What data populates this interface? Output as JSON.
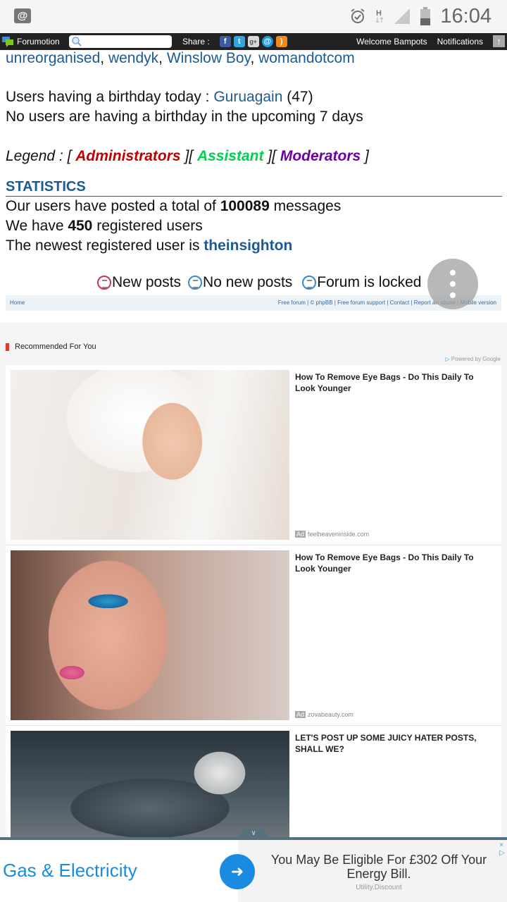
{
  "status_bar": {
    "notification_icon": "at-sign-icon",
    "icons": [
      "alarm-icon",
      "hspa-data-icon",
      "signal-icon",
      "battery-icon"
    ],
    "time": "16:04"
  },
  "topbar": {
    "brand": "Forumotion",
    "search_placeholder": "",
    "share_label": "Share :",
    "share_icons": [
      "facebook-icon",
      "twitter-icon",
      "google-plus-icon",
      "email-icon",
      "rss-icon"
    ],
    "welcome": "Welcome Bampots",
    "notifications": "Notifications"
  },
  "online_users": {
    "users": [
      "unreorganised",
      "wendyk",
      "Winslow Boy",
      "womandotcom"
    ],
    "separator": ", "
  },
  "birthdays": {
    "today_label": "Users having a birthday today : ",
    "today_user": "Guruagain",
    "today_age": " (47)",
    "upcoming": "No users are having a birthday in the upcoming 7 days"
  },
  "legend": {
    "prefix": "Legend : [ ",
    "groups": [
      {
        "name": "Administrators",
        "color": "#c00000"
      },
      {
        "name": "Assistant",
        "color": "#00d050"
      },
      {
        "name": "Moderators",
        "color": "#7000a0"
      }
    ],
    "sep1": " ][ ",
    "sep2": " ][ ",
    "suffix": " ]"
  },
  "statistics": {
    "heading": "STATISTICS",
    "posts_prefix": "Our users have posted a total of ",
    "posts_count": "100089",
    "posts_suffix": " messages",
    "users_prefix": "We have ",
    "users_count": "450",
    "users_suffix": " registered users",
    "newest_prefix": "The newest registered user is ",
    "newest_user": "theinsighton"
  },
  "icon_legend": [
    {
      "label": "New posts",
      "icon": "new-posts-icon",
      "color": "#d0304a"
    },
    {
      "label": "No new posts",
      "icon": "no-new-posts-icon",
      "color": "#3a88c8"
    },
    {
      "label": "Forum is locked",
      "icon": "forum-locked-icon",
      "color": "#3a88c8"
    }
  ],
  "footer": {
    "home": "Home",
    "links": [
      "Free forum",
      "© phpBB",
      "Free forum support",
      "Contact",
      "Report an abuse",
      "Mobile version"
    ],
    "separator": " | "
  },
  "recommended": {
    "title": "Recommended For You",
    "powered": "Powered by Google",
    "items": [
      {
        "title": "How To Remove Eye Bags - Do This Daily To Look Younger",
        "badge": "Ad",
        "source": "feelheaveninside.com",
        "image": "woman-towel-skincare-photo"
      },
      {
        "title": "How To Remove Eye Bags - Do This Daily To Look Younger",
        "badge": "Ad",
        "source": "zovabeauty.com",
        "image": "woman-blue-eye-makeup-photo"
      },
      {
        "title": "LET'S POST UP SOME JUICY HATER POSTS, SHALL WE?",
        "badge": "",
        "source": "",
        "image": "skull-armor-artwork"
      }
    ]
  },
  "bottom_ad": {
    "headline": "Gas & Electricity",
    "text": "You May Be Eligible For £302 Off Your Energy Bill.",
    "sponsor": "Utility.Discount",
    "close": "×",
    "adchoices": "▷",
    "collapse": "∨"
  }
}
